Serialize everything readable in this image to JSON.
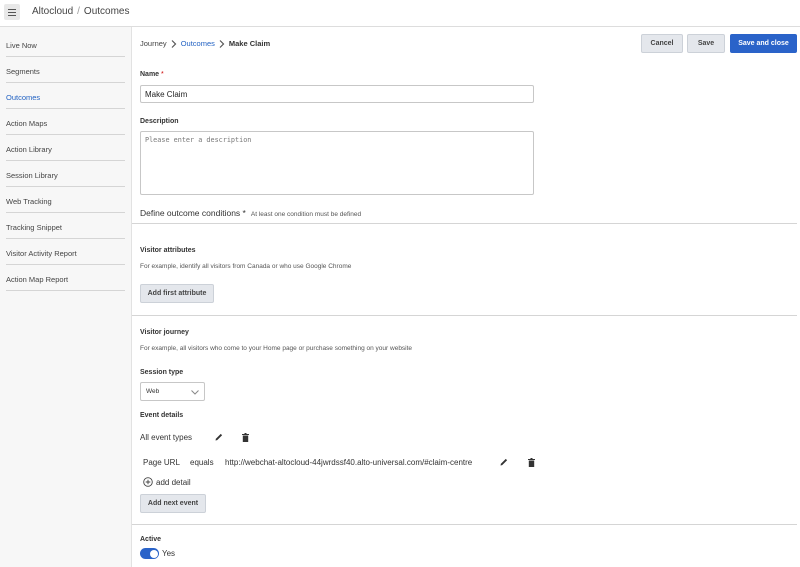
{
  "header": {
    "app_name": "Altocloud",
    "separator": "/",
    "section": "Outcomes"
  },
  "sidebar": {
    "items": [
      {
        "label": "Live Now"
      },
      {
        "label": "Segments"
      },
      {
        "label": "Outcomes",
        "active": true
      },
      {
        "label": "Action Maps"
      },
      {
        "label": "Action Library"
      },
      {
        "label": "Session Library"
      },
      {
        "label": "Web Tracking"
      },
      {
        "label": "Tracking Snippet"
      },
      {
        "label": "Visitor Activity Report"
      },
      {
        "label": "Action Map Report"
      }
    ]
  },
  "breadcrumb": {
    "root": "Journey",
    "parent": "Outcomes",
    "current": "Make Claim"
  },
  "actions": {
    "cancel": "Cancel",
    "save": "Save",
    "save_close": "Save and close"
  },
  "form": {
    "name_label": "Name",
    "required_mark": "*",
    "name_value": "Make Claim",
    "description_label": "Description",
    "description_placeholder": "Please enter a description",
    "conditions_title": "Define outcome conditions",
    "conditions_note": "At least one condition must be defined",
    "visitor_attributes": {
      "title": "Visitor attributes",
      "hint": "For example, identify all visitors from Canada or who use Google Chrome",
      "button": "Add first attribute"
    },
    "visitor_journey": {
      "title": "Visitor journey",
      "hint": "For example, all visitors who come to your Home page or purchase something on your website",
      "session_type_label": "Session type",
      "session_type_value": "Web",
      "event_details_label": "Event details",
      "event_types": "All event types",
      "condition": {
        "field": "Page URL",
        "operator": "equals",
        "value": "http://webchat-altocloud-44jwrdssf40.alto-universal.com/#claim-centre"
      },
      "add_detail": "add detail",
      "add_next_event": "Add next event"
    },
    "active_label": "Active",
    "active_value": "Yes"
  },
  "colors": {
    "accent": "#2a63c9",
    "link": "#2262c3"
  }
}
